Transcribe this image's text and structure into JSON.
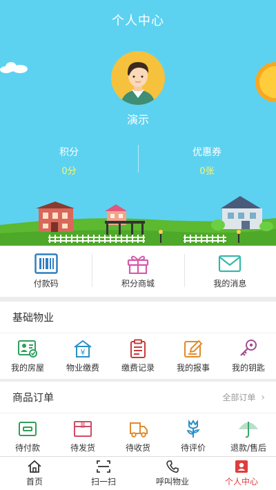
{
  "header": {
    "title": "个人中心"
  },
  "profile": {
    "name": "演示",
    "stats": [
      {
        "label": "积分",
        "value": "0分"
      },
      {
        "label": "优惠券",
        "value": "0张"
      }
    ]
  },
  "quick_actions": [
    {
      "label": "付款码",
      "icon": "barcode-icon",
      "color": "#2f7fbf"
    },
    {
      "label": "积分商城",
      "icon": "gift-icon",
      "color": "#d65aa8"
    },
    {
      "label": "我的消息",
      "icon": "mail-icon",
      "color": "#35b8a9"
    }
  ],
  "basic_property": {
    "title": "基础物业",
    "items": [
      {
        "label": "我的房屋",
        "icon": "house-card-icon",
        "color": "#2e9e5b"
      },
      {
        "label": "物业缴费",
        "icon": "fee-payment-icon",
        "color": "#2a8fc7"
      },
      {
        "label": "缴费记录",
        "icon": "clipboard-icon",
        "color": "#c9393a"
      },
      {
        "label": "我的报事",
        "icon": "edit-report-icon",
        "color": "#e08a2b"
      },
      {
        "label": "我的钥匙",
        "icon": "key-icon",
        "color": "#a04c8f"
      }
    ]
  },
  "orders": {
    "title": "商品订单",
    "all_link": "全部订单",
    "items": [
      {
        "label": "待付款",
        "icon": "wallet-icon",
        "color": "#2f9e5a"
      },
      {
        "label": "待发货",
        "icon": "package-icon",
        "color": "#d04a63"
      },
      {
        "label": "待收货",
        "icon": "truck-icon",
        "color": "#e08a2b"
      },
      {
        "label": "待评价",
        "icon": "flower-icon",
        "color": "#2a8fc7"
      },
      {
        "label": "退款/售后",
        "icon": "umbrella-icon",
        "color": "#3aa66a"
      }
    ]
  },
  "tabbar": {
    "active_color": "#e03c3c",
    "tabs": [
      {
        "label": "首页",
        "icon": "home-icon"
      },
      {
        "label": "扫一扫",
        "icon": "scan-icon"
      },
      {
        "label": "呼叫物业",
        "icon": "phone-icon"
      },
      {
        "label": "个人中心",
        "icon": "person-icon",
        "active": true
      }
    ]
  }
}
